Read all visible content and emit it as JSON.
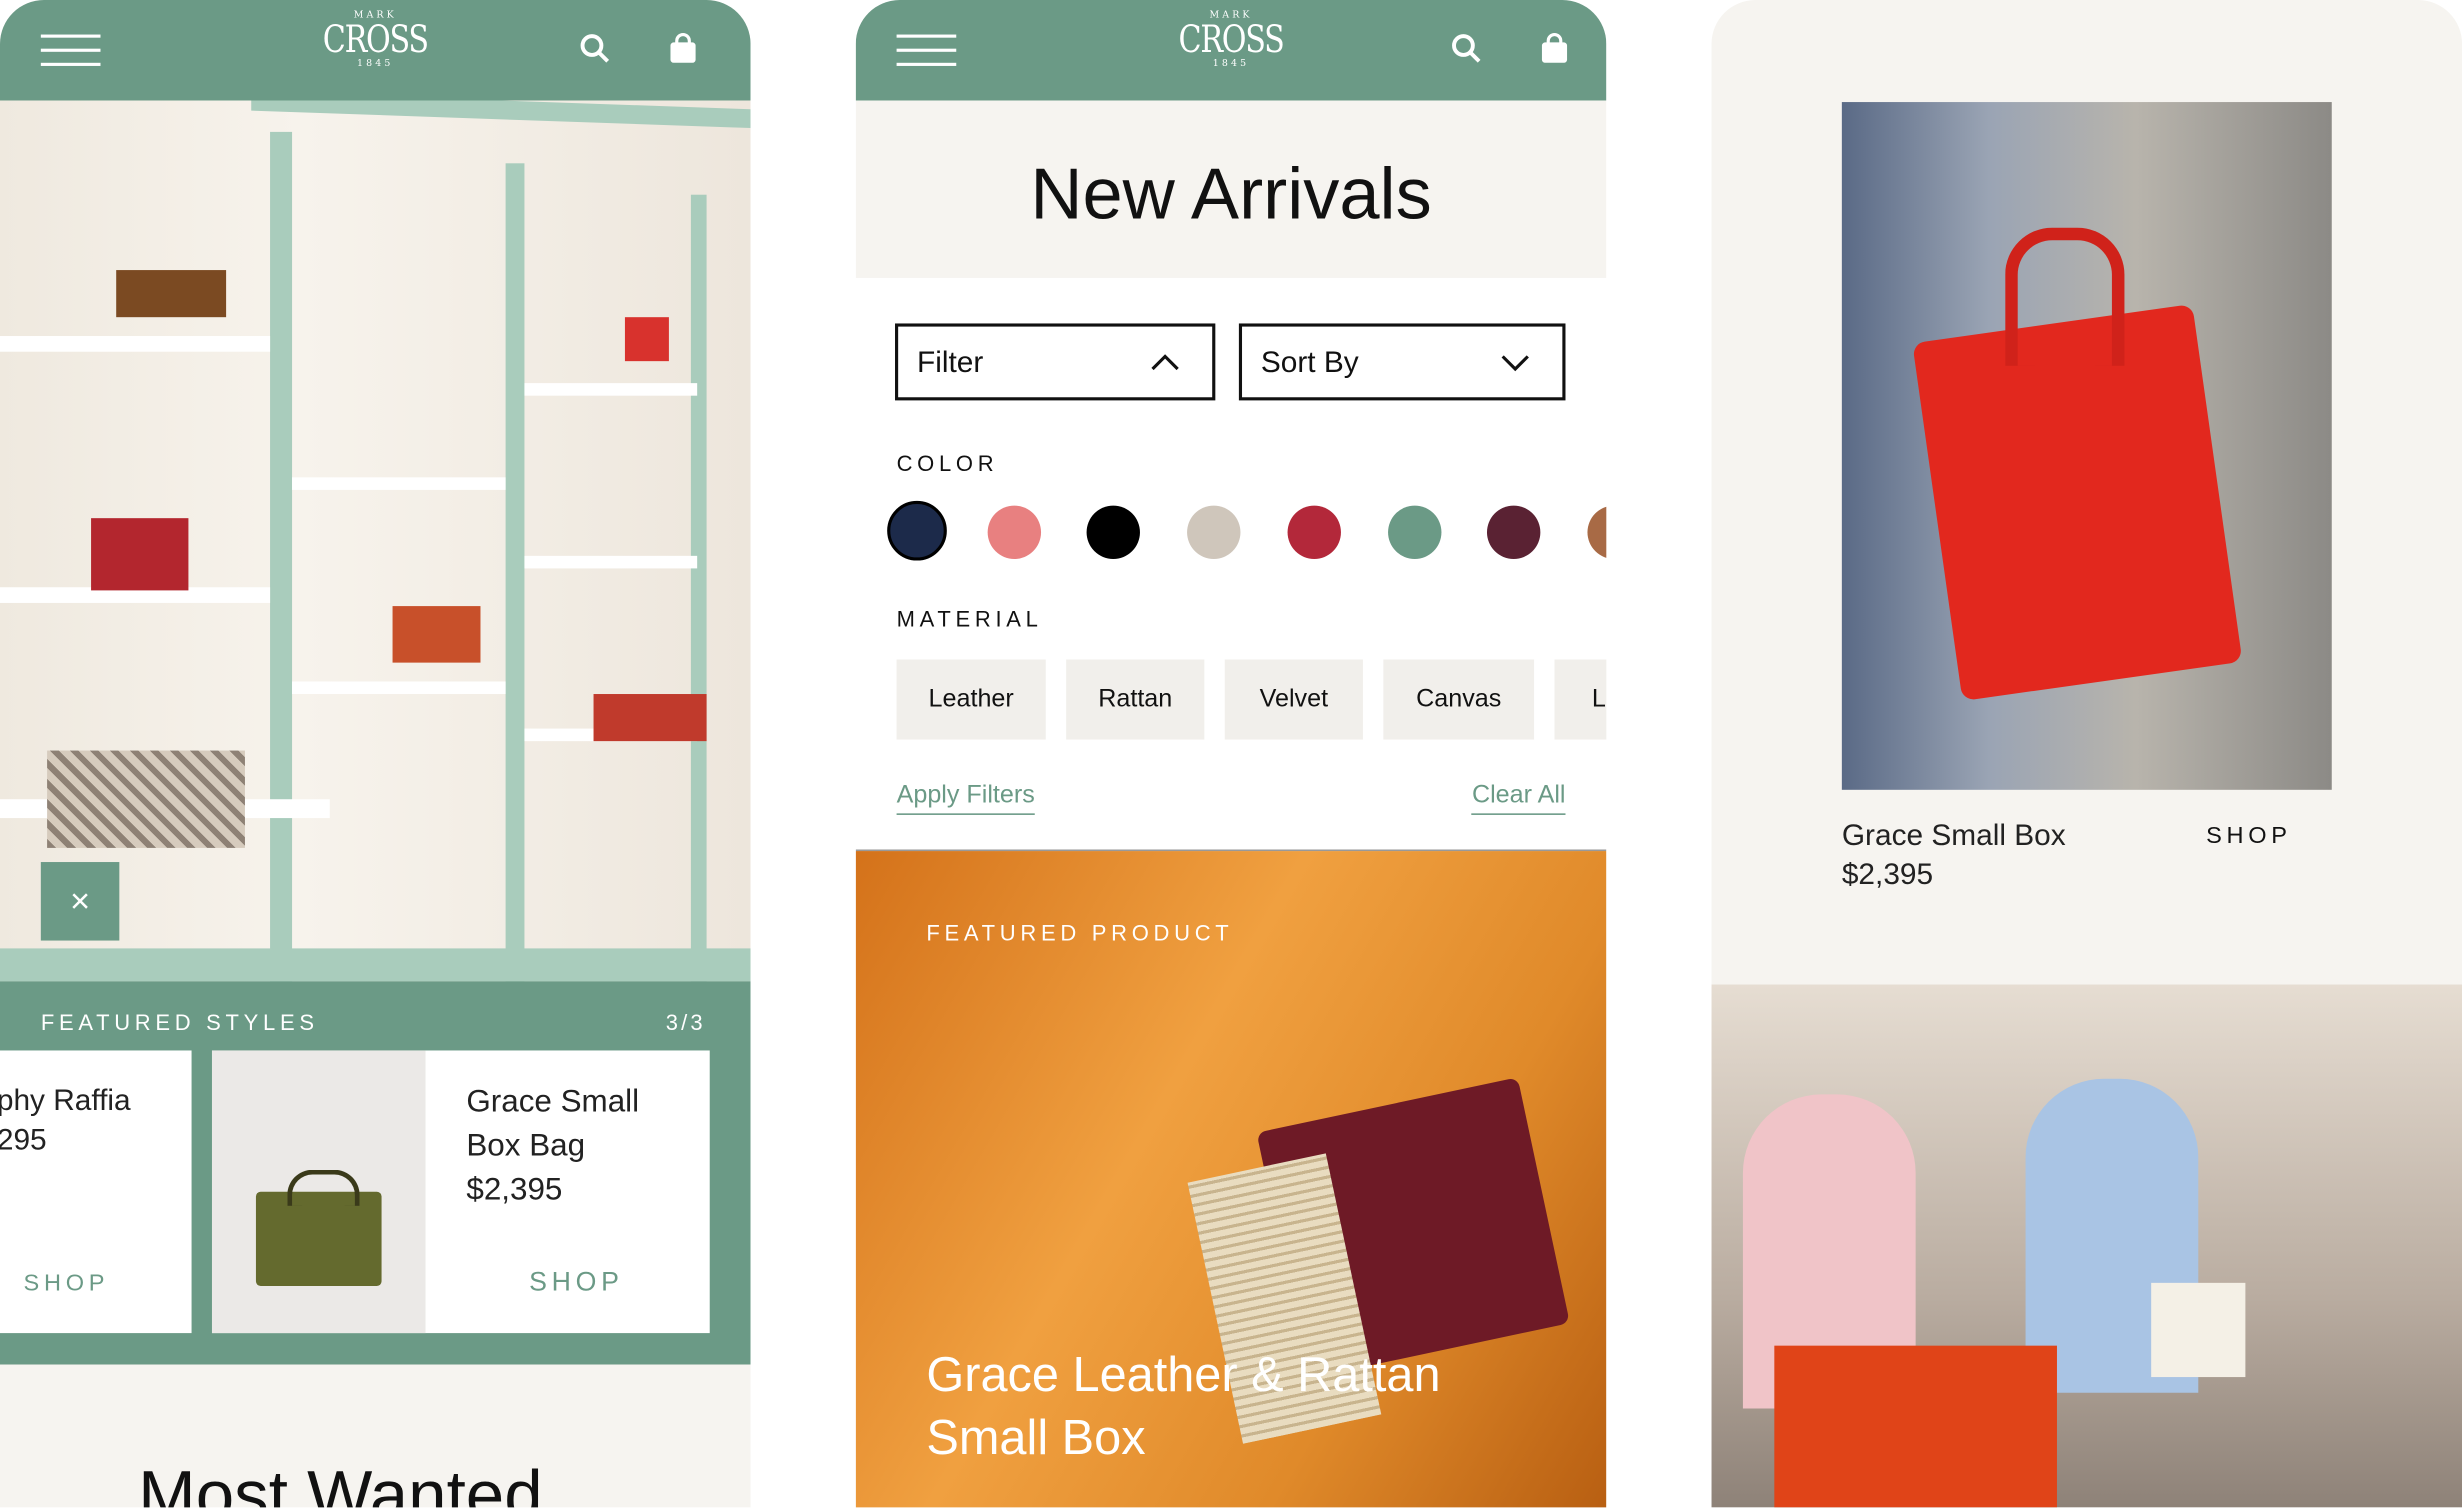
{
  "brand": {
    "logo_top": "MARK",
    "logo_main": "CROSS",
    "logo_year": "1845"
  },
  "colors": {
    "accent": "#6b9a86",
    "cream": "#f6f4f0"
  },
  "screen1": {
    "close_label": "×",
    "featured": {
      "title": "FEATURED STYLES",
      "count": "3/3"
    },
    "cards": [
      {
        "name": "phy Raffia",
        "price": "295",
        "cta": "SHOP"
      },
      {
        "name_line1": "Grace Small",
        "name_line2": "Box Bag",
        "price": "$2,395",
        "cta": "SHOP"
      }
    ],
    "section_title": "Most Wanted"
  },
  "screen2": {
    "title": "New Arrivals",
    "filter_label": "Filter",
    "sort_label": "Sort By",
    "color_heading": "COLOR",
    "swatches": [
      "#1c2a4a",
      "#e88080",
      "#000000",
      "#cfc6bb",
      "#b3283a",
      "#6b9a86",
      "#5a2233",
      "#a86a45"
    ],
    "material_heading": "MATERIAL",
    "materials": [
      "Leather",
      "Rattan",
      "Velvet",
      "Canvas",
      "Li"
    ],
    "apply_label": "Apply Filters",
    "clear_label": "Clear All",
    "featured_eyebrow": "FEATURED PRODUCT",
    "featured_line1": "Grace Leather & Rattan",
    "featured_line2": "Small Box"
  },
  "screen3": {
    "product_name": "Grace Small Box",
    "price": "$2,395",
    "cta": "SHOP"
  }
}
